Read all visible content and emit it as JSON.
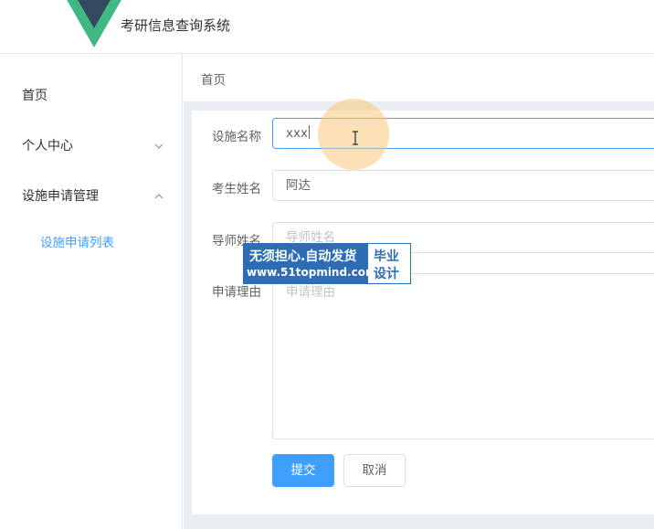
{
  "header": {
    "title": "考研信息查询系统",
    "logo_icon": "vue-logo-icon"
  },
  "sidebar": {
    "items": [
      {
        "label": "首页"
      },
      {
        "label": "个人中心"
      },
      {
        "label": "设施申请管理"
      }
    ],
    "subitems": [
      {
        "label": "设施申请列表"
      }
    ]
  },
  "breadcrumb": {
    "label": "首页"
  },
  "form": {
    "facility_label": "设施名称",
    "facility_value": "xxx",
    "student_label": "考生姓名",
    "student_value": "阿达",
    "tutor_label": "导师姓名",
    "tutor_placeholder": "导师姓名",
    "reason_label": "申请理由",
    "reason_placeholder": "申请理由"
  },
  "buttons": {
    "submit": "提交",
    "cancel": "取消"
  },
  "watermark": {
    "line1": "无须担心.自动发货",
    "line2": "www.51topmind.com",
    "tag1": "毕业",
    "tag2": "设计"
  },
  "colors": {
    "primary": "#409eff",
    "watermark": "#2e6db4"
  }
}
